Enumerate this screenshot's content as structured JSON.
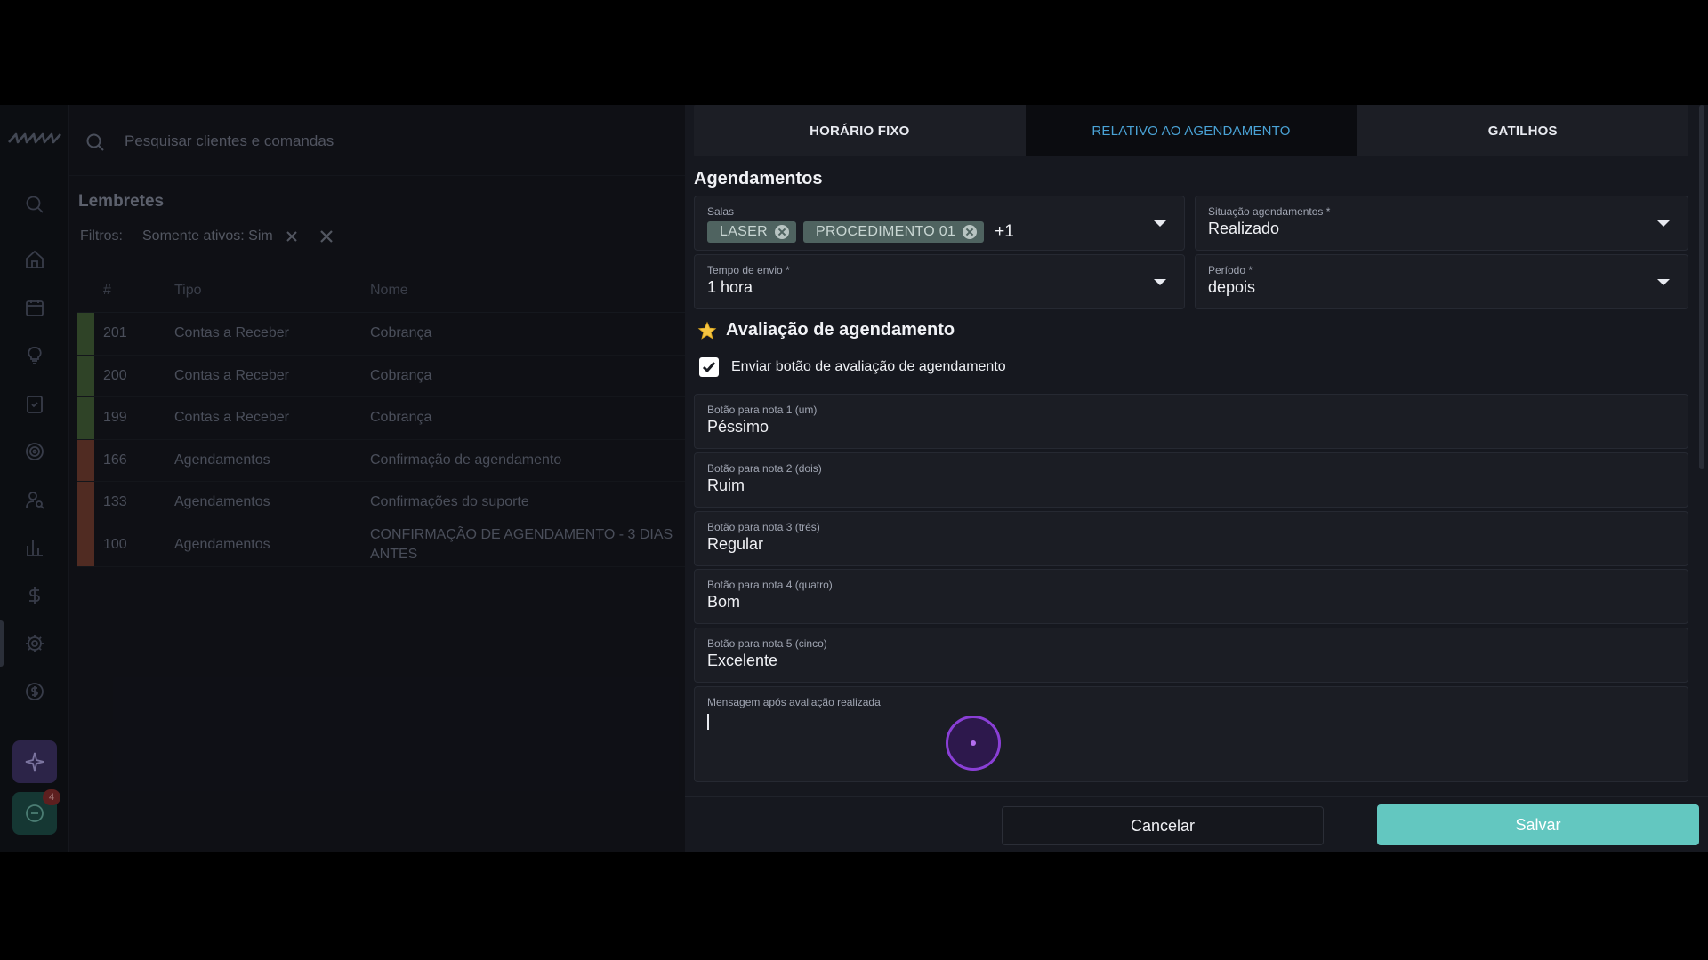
{
  "search": {
    "placeholder": "Pesquisar clientes e comandas"
  },
  "sidebar": {
    "icons": [
      "search-icon",
      "home-icon",
      "calendar-icon",
      "lightbulb-icon",
      "clipboard-check-icon",
      "target-icon",
      "user-search-icon",
      "bar-chart-icon",
      "dollar-icon",
      "gear-icon",
      "dollar-circle-icon"
    ],
    "ai_icon": "sparkle-icon",
    "chat_icon": "chat-icon",
    "chat_badge": "4"
  },
  "list": {
    "title": "Lembretes",
    "filters_label": "Filtros:",
    "filter_chip": "Somente ativos: Sim",
    "columns": [
      "#",
      "Tipo",
      "Nome"
    ],
    "rows": [
      {
        "num": "201",
        "type": "Contas a Receber",
        "name": "Cobrança",
        "color": "#3f5a35"
      },
      {
        "num": "200",
        "type": "Contas a Receber",
        "name": "Cobrança",
        "color": "#3f5a35"
      },
      {
        "num": "199",
        "type": "Contas a Receber",
        "name": "Cobrança",
        "color": "#3f5a35"
      },
      {
        "num": "166",
        "type": "Agendamentos",
        "name": "Confirmação de agendamento",
        "color": "#6b3a2e"
      },
      {
        "num": "133",
        "type": "Agendamentos",
        "name": "Confirmações do suporte",
        "color": "#6b3a2e"
      },
      {
        "num": "100",
        "type": "Agendamentos",
        "name": "CONFIRMAÇÃO DE AGENDAMENTO - 3 DIAS ANTES",
        "color": "#6b3a2e"
      }
    ]
  },
  "dialog": {
    "tabs": [
      {
        "label": "HORÁRIO FIXO",
        "active": false
      },
      {
        "label": "RELATIVO AO AGENDAMENTO",
        "active": true
      },
      {
        "label": "GATILHOS",
        "active": false
      }
    ],
    "section_title": "Agendamentos",
    "salas": {
      "label": "Salas",
      "tags": [
        "LASER",
        "PROCEDIMENTO 01"
      ],
      "more": "+1"
    },
    "situacao": {
      "label": "Situação agendamentos",
      "required": "*",
      "value": "Realizado"
    },
    "tempo": {
      "label": "Tempo de envio",
      "required": "*",
      "value": "1 hora"
    },
    "periodo": {
      "label": "Período",
      "required": "*",
      "value": "depois"
    },
    "rating": {
      "title": "Avaliação de agendamento",
      "check_label": "Enviar botão de avaliação de agendamento",
      "checked": true,
      "buttons": [
        {
          "label": "Botão para nota 1 (um)",
          "value": "Péssimo"
        },
        {
          "label": "Botão para nota 2 (dois)",
          "value": "Ruim"
        },
        {
          "label": "Botão para nota 3 (três)",
          "value": "Regular"
        },
        {
          "label": "Botão para nota 4 (quatro)",
          "value": "Bom"
        },
        {
          "label": "Botão para nota 5 (cinco)",
          "value": "Excelente"
        }
      ],
      "message_label": "Mensagem após avaliação realizada",
      "message_value": ""
    },
    "cancel_label": "Cancelar",
    "save_label": "Salvar"
  },
  "colors": {
    "accent": "#4aa3d6",
    "save": "#63c7c0",
    "tag": "#4f6360"
  }
}
